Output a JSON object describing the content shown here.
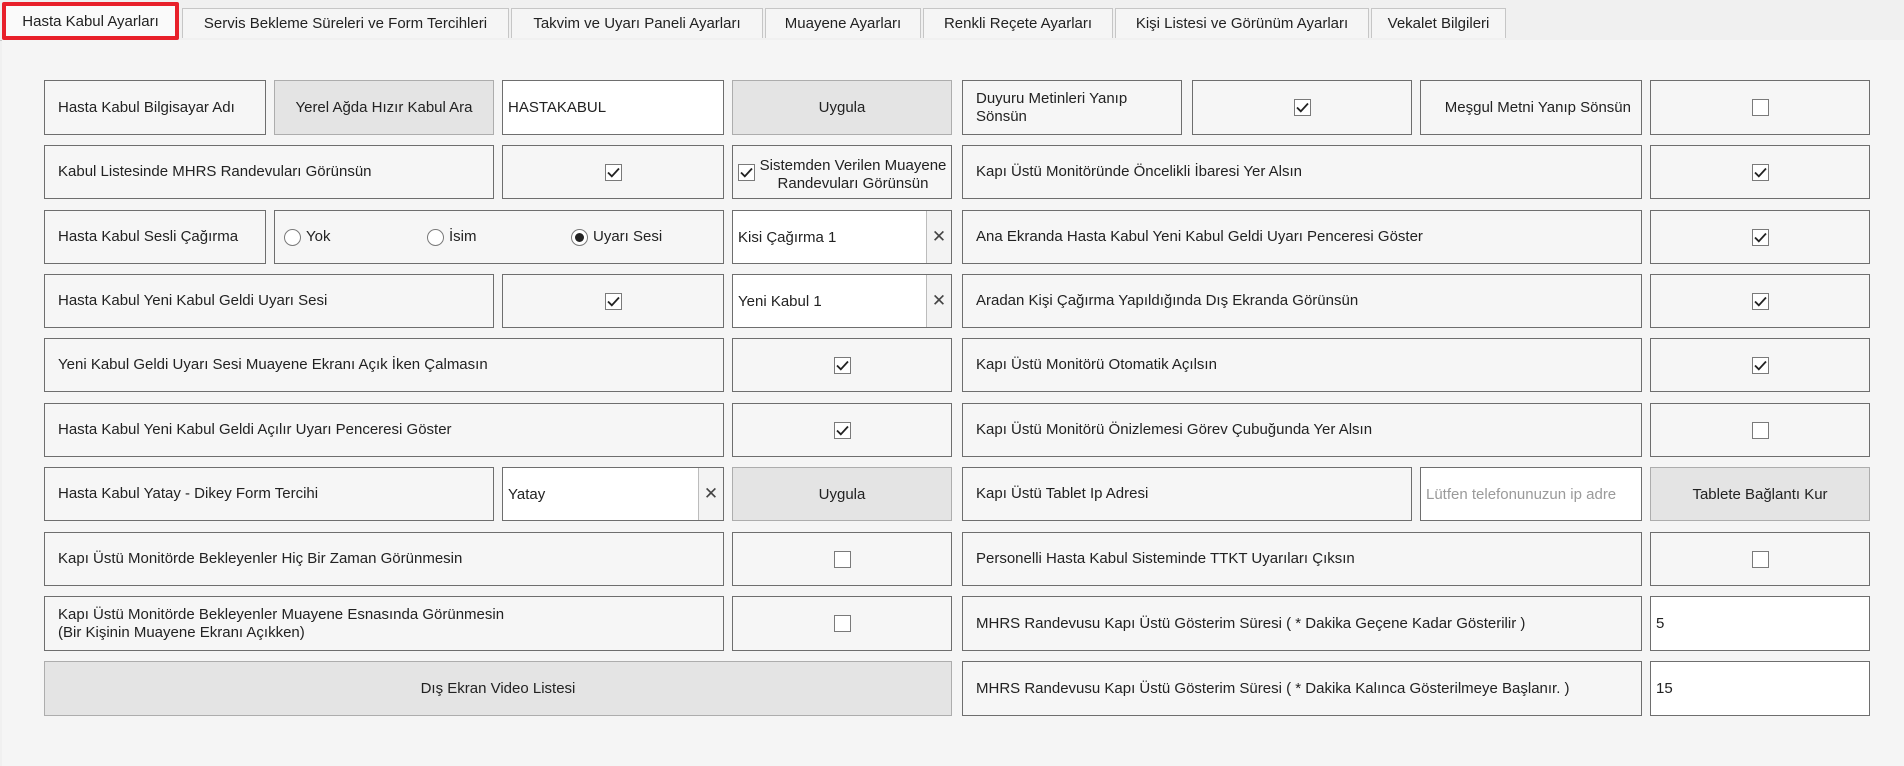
{
  "tabs": [
    {
      "label": "Hasta Kabul Ayarları",
      "active": true
    },
    {
      "label": "Servis Bekleme Süreleri ve Form Tercihleri"
    },
    {
      "label": "Takvim ve Uyarı Paneli Ayarları"
    },
    {
      "label": "Muayene Ayarları"
    },
    {
      "label": "Renkli Reçete Ayarları"
    },
    {
      "label": "Kişi Listesi ve Görünüm Ayarları"
    },
    {
      "label": "Vekalet Bilgileri"
    }
  ],
  "left": {
    "computer_name_label": "Hasta Kabul Bilgisayar Adı",
    "search_button": "Yerel Ağda Hızır Kabul Ara",
    "computer_name_value": "HASTAKABUL",
    "apply1": "Uygula",
    "mhrs_visible_label": "Kabul Listesinde MHRS Randevuları Görünsün",
    "mhrs_visible_checked": true,
    "system_appt_label": "Sistemden Verilen Muayene Randevuları Görünsün",
    "system_appt_checked": true,
    "voice_call_label": "Hasta Kabul Sesli Çağırma",
    "radio_none": "Yok",
    "radio_name": "İsim",
    "radio_alert": "Uyarı Sesi",
    "radio_selected": "alert",
    "voice_select": "Kisi Çağırma 1",
    "new_sound_label": "Hasta Kabul Yeni Kabul Geldi Uyarı Sesi",
    "new_sound_checked": true,
    "new_sound_select": "Yeni Kabul 1",
    "no_play_label": "Yeni Kabul Geldi Uyarı Sesi Muayene Ekranı Açık İken Çalmasın",
    "no_play_checked": true,
    "popup_label": "Hasta Kabul Yeni Kabul Geldi Açılır Uyarı Penceresi Göster",
    "popup_checked": true,
    "orientation_label": "Hasta Kabul Yatay - Dikey Form Tercihi",
    "orientation_value": "Yatay",
    "apply2": "Uygula",
    "waiting_never_label": "Kapı Üstü Monitörde Bekleyenler Hiç Bir Zaman Görünmesin",
    "waiting_never_checked": false,
    "waiting_exam_label_1": "Kapı Üstü Monitörde Bekleyenler Muayene Esnasında Görünmesin",
    "waiting_exam_label_2": "(Bir Kişinin Muayene Ekranı Açıkken)",
    "waiting_exam_checked": false,
    "video_list_button": "Dış Ekran Video Listesi"
  },
  "right": {
    "blink_announce_label": "Duyuru Metinleri Yanıp Sönsün",
    "blink_announce_checked": true,
    "blink_busy_label": "Meşgul Metni Yanıp Sönsün",
    "blink_busy_checked": false,
    "priority_label": "Kapı Üstü Monitöründe Öncelikli İbaresi Yer Alsın",
    "priority_checked": true,
    "new_window_label": "Ana Ekranda Hasta Kabul Yeni Kabul Geldi Uyarı Penceresi Göster",
    "new_window_checked": true,
    "external_call_label": "Aradan Kişi Çağırma Yapıldığında Dış Ekranda Görünsün",
    "external_call_checked": true,
    "auto_open_label": "Kapı Üstü Monitörü Otomatik Açılsın",
    "auto_open_checked": true,
    "taskbar_label": "Kapı Üstü Monitörü Önizlemesi Görev Çubuğunda Yer Alsın",
    "taskbar_checked": false,
    "tablet_ip_label": "Kapı Üstü Tablet Ip Adresi",
    "tablet_ip_placeholder": "Lütfen telefonunuzun ip adre",
    "tablet_connect_button": "Tablete Bağlantı Kur",
    "ttkt_label": "Personelli Hasta Kabul Sisteminde TTKT Uyarıları Çıksın",
    "ttkt_checked": false,
    "mhrs_time1_label": "MHRS Randevusu Kapı Üstü Gösterim Süresi ( * Dakika Geçene Kadar Gösterilir )",
    "mhrs_time1_value": "5",
    "mhrs_time2_label": "MHRS Randevusu Kapı Üstü Gösterim Süresi ( * Dakika Kalınca Gösterilmeye Başlanır. )",
    "mhrs_time2_value": "15"
  }
}
